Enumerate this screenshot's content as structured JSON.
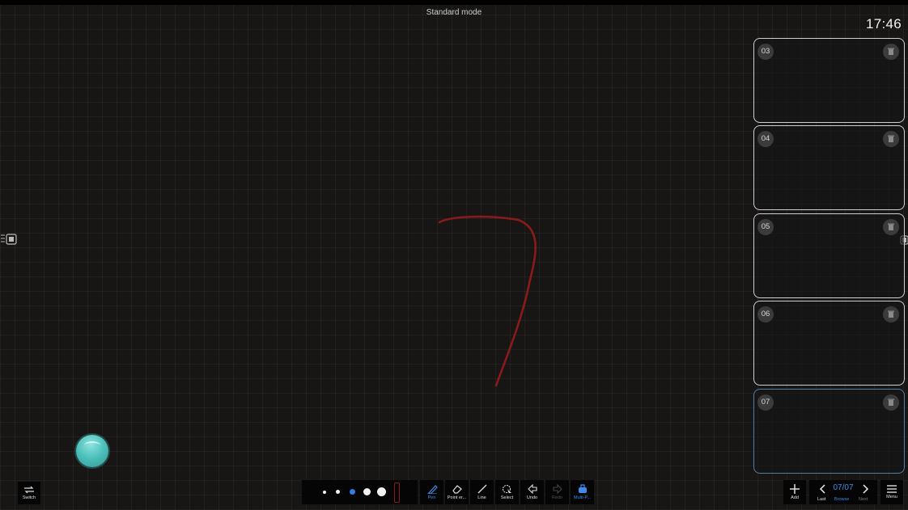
{
  "header": {
    "mode": "Standard mode",
    "clock": "17:46"
  },
  "pages": [
    {
      "num": "03",
      "active": false
    },
    {
      "num": "04",
      "active": false
    },
    {
      "num": "05",
      "active": false
    },
    {
      "num": "06",
      "active": false
    },
    {
      "num": "07",
      "active": true
    }
  ],
  "toolbar": {
    "switch_label": "Switch",
    "pen_sizes": [
      "size-1",
      "size-2",
      "size-3",
      "size-4",
      "size-5"
    ],
    "selected_pen_size_index": 2,
    "pen_color": "#8b1a1a",
    "tools": [
      {
        "label": "Pen",
        "icon": "pen-icon",
        "state": "active"
      },
      {
        "label": "Point er...",
        "icon": "eraser-icon",
        "state": "normal"
      },
      {
        "label": "Line",
        "icon": "line-icon",
        "state": "normal"
      },
      {
        "label": "Select",
        "icon": "select-icon",
        "state": "normal"
      },
      {
        "label": "Undo",
        "icon": "undo-icon",
        "state": "normal"
      },
      {
        "label": "Redo",
        "icon": "redo-icon",
        "state": "disabled"
      },
      {
        "label": "Multi-P...",
        "icon": "multi-pen-icon",
        "state": "active"
      }
    ],
    "add_label": "Add",
    "page_count": "07/07",
    "last_label": "Last",
    "browse_label": "Browse",
    "next_label": "Next",
    "menu_label": "Menu"
  },
  "colors": {
    "background": "#171615",
    "accent": "#3d8ce6",
    "stroke": "#8b1a1a",
    "float_ball": "#4fc2bd"
  }
}
